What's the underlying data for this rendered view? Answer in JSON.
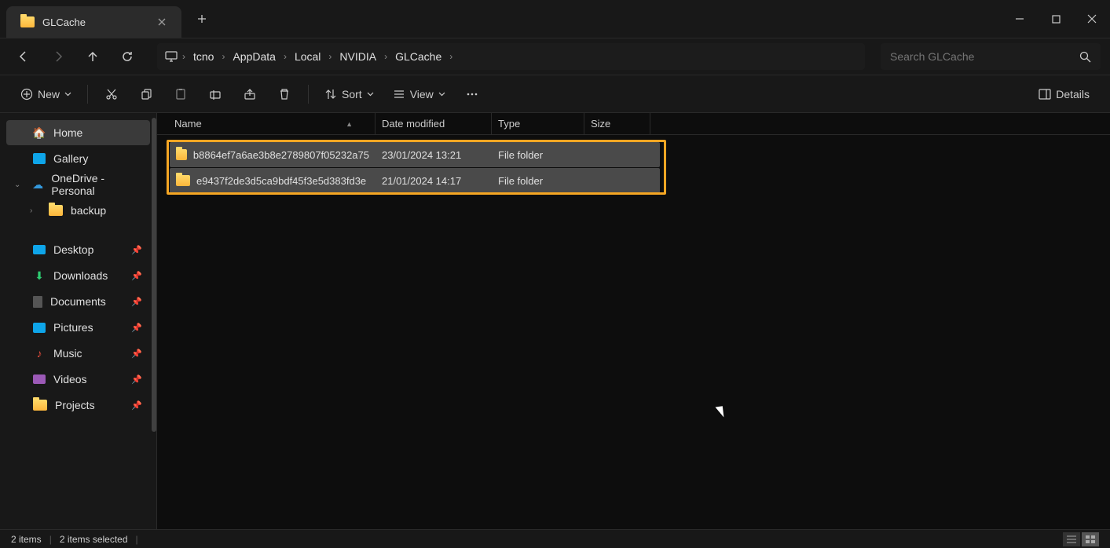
{
  "window": {
    "title": "GLCache"
  },
  "breadcrumb": [
    "tcno",
    "AppData",
    "Local",
    "NVIDIA",
    "GLCache"
  ],
  "search": {
    "placeholder": "Search GLCache"
  },
  "toolbar": {
    "new": "New",
    "sort": "Sort",
    "view": "View",
    "details": "Details"
  },
  "sidebar": {
    "home": "Home",
    "gallery": "Gallery",
    "onedrive": "OneDrive - Personal",
    "backup": "backup",
    "desktop": "Desktop",
    "downloads": "Downloads",
    "documents": "Documents",
    "pictures": "Pictures",
    "music": "Music",
    "videos": "Videos",
    "projects": "Projects"
  },
  "columns": {
    "name": "Name",
    "date": "Date modified",
    "type": "Type",
    "size": "Size"
  },
  "rows": [
    {
      "name": "b8864ef7a6ae3b8e2789807f05232a75",
      "date": "23/01/2024 13:21",
      "type": "File folder",
      "size": ""
    },
    {
      "name": "e9437f2de3d5ca9bdf45f3e5d383fd3e",
      "date": "21/01/2024 14:17",
      "type": "File folder",
      "size": ""
    }
  ],
  "status": {
    "items": "2 items",
    "selected": "2 items selected"
  }
}
